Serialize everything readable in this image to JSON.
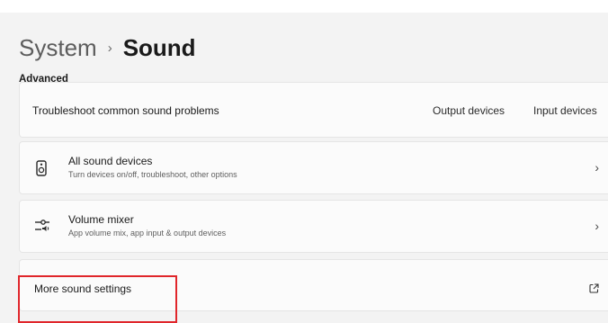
{
  "breadcrumb": {
    "parent": "System",
    "separator": "›",
    "current": "Sound"
  },
  "section": {
    "label": "Advanced"
  },
  "troubleshoot": {
    "title": "Troubleshoot common sound problems",
    "links": [
      "Output devices",
      "Input devices"
    ]
  },
  "all_devices": {
    "title": "All sound devices",
    "subtitle": "Turn devices on/off, troubleshoot, other options",
    "icon": "speaker-icon"
  },
  "volume_mixer": {
    "title": "Volume mixer",
    "subtitle": "App volume mix, app input & output devices",
    "icon": "mixer-icon"
  },
  "more_settings": {
    "title": "More sound settings",
    "icon": "external-link-icon"
  },
  "colors": {
    "highlight": "#e0262b",
    "card": "#fbfbfb",
    "background": "#f3f3f3"
  }
}
